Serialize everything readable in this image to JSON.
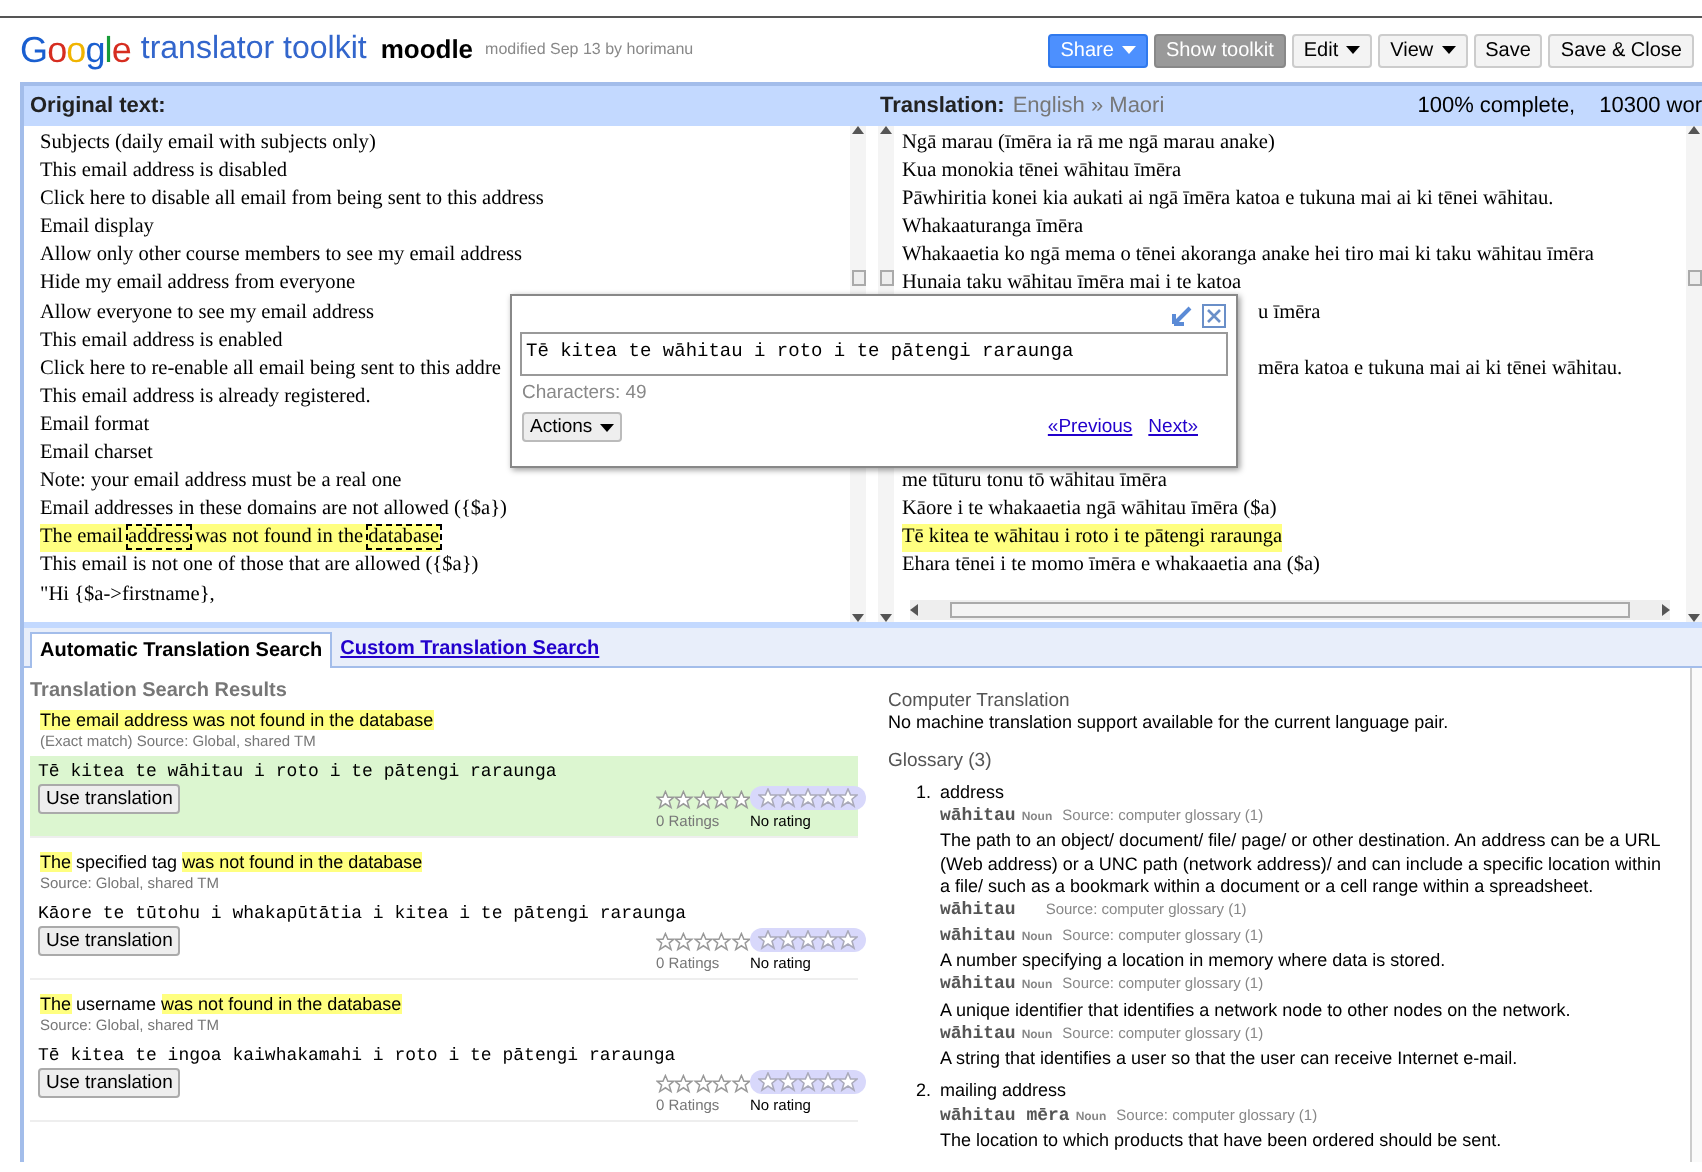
{
  "header": {
    "logo": "Google",
    "product": "translator toolkit",
    "document": "moodle",
    "modified": "modified Sep 13 by horimanu",
    "buttons": [
      {
        "label": "Share",
        "kind": "primary",
        "menu": true
      },
      {
        "label": "Show toolkit",
        "kind": "toggle",
        "menu": false
      },
      {
        "label": "Edit",
        "kind": "plain",
        "menu": true
      },
      {
        "label": "View",
        "kind": "plain",
        "menu": true
      },
      {
        "label": "Save",
        "kind": "plain",
        "menu": false
      },
      {
        "label": "Save & Close",
        "kind": "plain",
        "menu": false
      }
    ]
  },
  "original": {
    "title": "Original text:",
    "lines": [
      {
        "text": "Subjects (daily email with subjects only)",
        "selected": false
      },
      {
        "text": "This email address is disabled",
        "selected": false
      },
      {
        "text": "Click here to disable all email from being sent to this address",
        "selected": false
      },
      {
        "text": "Email display",
        "selected": false
      },
      {
        "text": "Allow only other course members to see my email address",
        "selected": false
      },
      {
        "text": "Hide my email address from everyone",
        "selected": false
      },
      {
        "text": "Allow everyone to see my email address",
        "selected": false
      },
      {
        "text": "This email address is enabled",
        "selected": false
      },
      {
        "text": "Click here to re-enable all email being sent to this addre",
        "selected": false
      },
      {
        "text": "This email address is already registered.",
        "selected": false
      },
      {
        "text": "Email format",
        "selected": false
      },
      {
        "text": "Email charset",
        "selected": false
      },
      {
        "text": "Note: your email address must be a real one",
        "selected": false
      },
      {
        "text": "Email addresses in these domains are not allowed ({$a})",
        "selected": false
      },
      {
        "parts": [
          {
            "text": "The email ",
            "term": false
          },
          {
            "text": "address",
            "term": true
          },
          {
            "text": " was not found in the ",
            "term": false
          },
          {
            "text": "database",
            "term": true
          }
        ],
        "selected": true
      },
      {
        "text": "This email is not one of those that are allowed ({$a})",
        "selected": false
      },
      {
        "text": "\"Hi {$a->firstname},",
        "selected": false
      }
    ]
  },
  "translation": {
    "label": "Translation:",
    "languages": "English » Maori",
    "progress": "100% complete,",
    "words": "10300 wor",
    "lines": [
      {
        "text": "Ngā marau (īmēra ia rā me ngā marau anake)",
        "kind": "full",
        "selected": false
      },
      {
        "text": "Kua monokia tēnei wāhitau īmēra",
        "kind": "full",
        "selected": false
      },
      {
        "text": "Pāwhiritia konei kia aukati ai ngā īmēra katoa e tukuna mai ai ki tēnei wāhitau.",
        "kind": "full",
        "selected": false
      },
      {
        "text": "Whakaaturanga īmēra",
        "kind": "full",
        "selected": false
      },
      {
        "text": "Whakaaetia ko ngā mema o tēnei akoranga anake hei tiro mai ki taku wāhitau īmēra",
        "kind": "full",
        "selected": false
      },
      {
        "text": "Hunaia taku wāhitau īmēra mai i te katoa",
        "kind": "full",
        "selected": false
      },
      {
        "text": "u īmēra",
        "kind": "partial",
        "selected": false
      },
      {
        "kind": "hidden",
        "selected": false
      },
      {
        "text": "mēra katoa e tukuna mai ai ki tēnei wāhitau.",
        "kind": "partial",
        "selected": false
      },
      {
        "kind": "hidden",
        "selected": false
      },
      {
        "kind": "hidden",
        "selected": false
      },
      {
        "kind": "hidden",
        "selected": false
      },
      {
        "text": "me tūturu tonu tō wāhitau īmēra",
        "kind": "full",
        "selected": false
      },
      {
        "text": "Kāore i te whakaaetia ngā wāhitau īmēra ($a)",
        "kind": "full",
        "selected": false
      },
      {
        "text": "Tē kitea te wāhitau i roto i te pātengi raraunga",
        "kind": "full",
        "selected": true
      },
      {
        "text": "Ehara tēnei i te momo īmēra e whakaaetia ana ($a)",
        "kind": "full",
        "selected": false
      }
    ]
  },
  "editor": {
    "value": "Tē kitea te wāhitau i roto i te pātengi raraunga",
    "characters": "Characters: 49",
    "actions": "Actions",
    "previous": "«Previous",
    "next": "Next»"
  },
  "tabs": [
    {
      "label": "Automatic Translation Search",
      "selected": true
    },
    {
      "label": "Custom Translation Search",
      "selected": false
    }
  ],
  "results": {
    "title": "Translation Search Results",
    "items": [
      {
        "query": [
          {
            "text": "The email address was not found in the database",
            "highlight": true
          }
        ],
        "source": "(Exact match) Source: Global, shared TM",
        "translation": "Tē kitea te wāhitau i roto i te pātengi raraunga",
        "button": "Use translation",
        "ratings": "0 Ratings",
        "rating": "No rating",
        "stars": 0,
        "selected": true
      },
      {
        "query": [
          {
            "text": "The",
            "highlight": true
          },
          {
            "text": " specified tag ",
            "highlight": false
          },
          {
            "text": "was not found in the database",
            "highlight": true
          }
        ],
        "source": "Source: Global, shared TM",
        "translation": "Kāore te tūtohu i whakapūtātia i kitea i te pātengi raraunga",
        "button": "Use translation",
        "ratings": "0 Ratings",
        "rating": "No rating",
        "stars": 0,
        "selected": false
      },
      {
        "query": [
          {
            "text": "The",
            "highlight": true
          },
          {
            "text": " username ",
            "highlight": false
          },
          {
            "text": "was not found in the database",
            "highlight": true
          }
        ],
        "source": "Source: Global, shared TM",
        "translation": "Tē kitea te ingoa kaiwhakamahi i roto i te pātengi raraunga",
        "button": "Use translation",
        "ratings": "0 Ratings",
        "rating": "No rating",
        "stars": 0,
        "selected": false
      }
    ]
  },
  "computer_translation": {
    "title": "Computer Translation",
    "message": "No machine translation support available for the current language pair."
  },
  "glossary": {
    "title": "Glossary (3)",
    "items": [
      {
        "number": "1.",
        "term": "address",
        "entries": [
          {
            "word": "wāhitau",
            "pos": "Noun",
            "source": "Source: computer glossary (1)",
            "definition": "The path to an object/ document/ file/ page/ or other destination. An address can be a URL (Web address) or a UNC path (network address)/ and can include a specific location within a file/ such as a bookmark within a document or a cell range within a spreadsheet."
          },
          {
            "word": "wāhitau",
            "source": "Source: computer glossary (1)"
          },
          {
            "word": "wāhitau",
            "pos": "Noun",
            "source": "Source: computer glossary (1)",
            "definition": "A number specifying a location in memory where data is stored."
          },
          {
            "word": "wāhitau",
            "pos": "Noun",
            "source": "Source: computer glossary (1)",
            "definition": "A unique identifier that identifies a network node to other nodes on the network."
          },
          {
            "word": "wāhitau",
            "pos": "Noun",
            "source": "Source: computer glossary (1)",
            "definition": "A string that identifies a user so that the user can receive Internet e-mail."
          }
        ]
      },
      {
        "number": "2.",
        "term": "mailing address",
        "entries": [
          {
            "word": "wāhitau mēra",
            "pos": "Noun",
            "source": "Source: computer glossary (1)",
            "definition": "The location to which products that have been ordered should be sent."
          }
        ]
      }
    ]
  }
}
